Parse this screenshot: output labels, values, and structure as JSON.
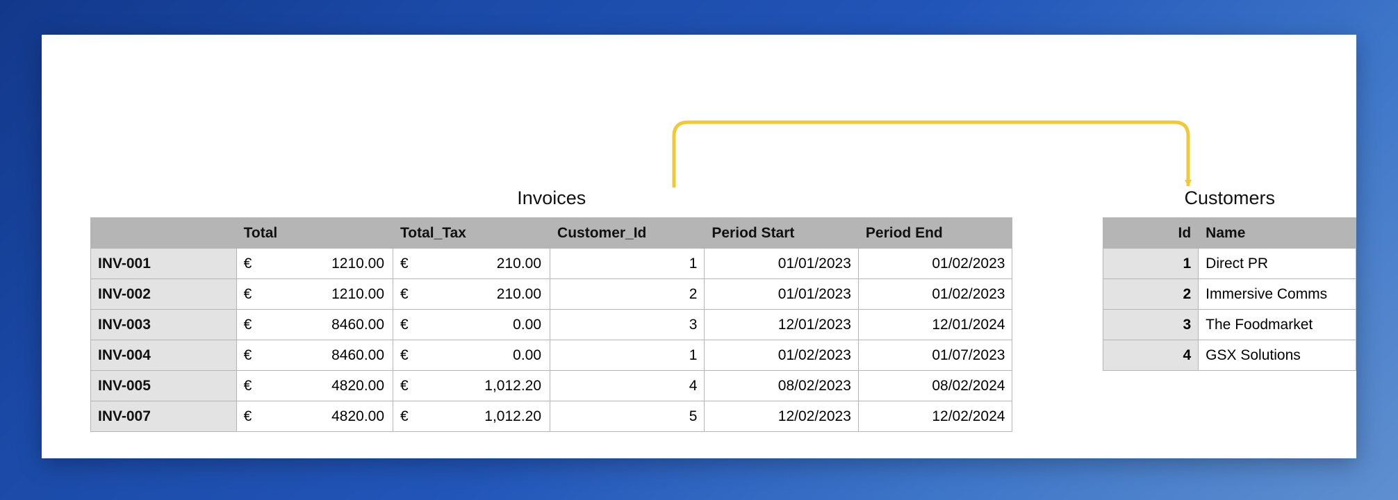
{
  "invoices": {
    "title": "Invoices",
    "columns": {
      "id": "",
      "total": "Total",
      "total_tax": "Total_Tax",
      "customer_id": "Customer_Id",
      "period_start": "Period Start",
      "period_end": "Period End"
    },
    "currency_symbol": "€",
    "rows": [
      {
        "id": "INV-001",
        "total": "1210.00",
        "total_tax": "210.00",
        "customer_id": "1",
        "period_start": "01/01/2023",
        "period_end": "01/02/2023"
      },
      {
        "id": "INV-002",
        "total": "1210.00",
        "total_tax": "210.00",
        "customer_id": "2",
        "period_start": "01/01/2023",
        "period_end": "01/02/2023"
      },
      {
        "id": "INV-003",
        "total": "8460.00",
        "total_tax": "0.00",
        "customer_id": "3",
        "period_start": "12/01/2023",
        "period_end": "12/01/2024"
      },
      {
        "id": "INV-004",
        "total": "8460.00",
        "total_tax": "0.00",
        "customer_id": "1",
        "period_start": "01/02/2023",
        "period_end": "01/07/2023"
      },
      {
        "id": "INV-005",
        "total": "4820.00",
        "total_tax": "1,012.20",
        "customer_id": "4",
        "period_start": "08/02/2023",
        "period_end": "08/02/2024"
      },
      {
        "id": "INV-007",
        "total": "4820.00",
        "total_tax": "1,012.20",
        "customer_id": "5",
        "period_start": "12/02/2023",
        "period_end": "12/02/2024"
      }
    ]
  },
  "customers": {
    "title": "Customers",
    "columns": {
      "id": "Id",
      "name": "Name"
    },
    "rows": [
      {
        "id": "1",
        "name": "Direct PR"
      },
      {
        "id": "2",
        "name": "Immersive Comms"
      },
      {
        "id": "3",
        "name": "The Foodmarket"
      },
      {
        "id": "4",
        "name": "GSX Solutions"
      }
    ]
  },
  "relationship": {
    "from_table": "Invoices",
    "from_column": "Customer_Id",
    "to_table": "Customers",
    "to_column": "Id",
    "arrow_color": "#f0c83b"
  }
}
